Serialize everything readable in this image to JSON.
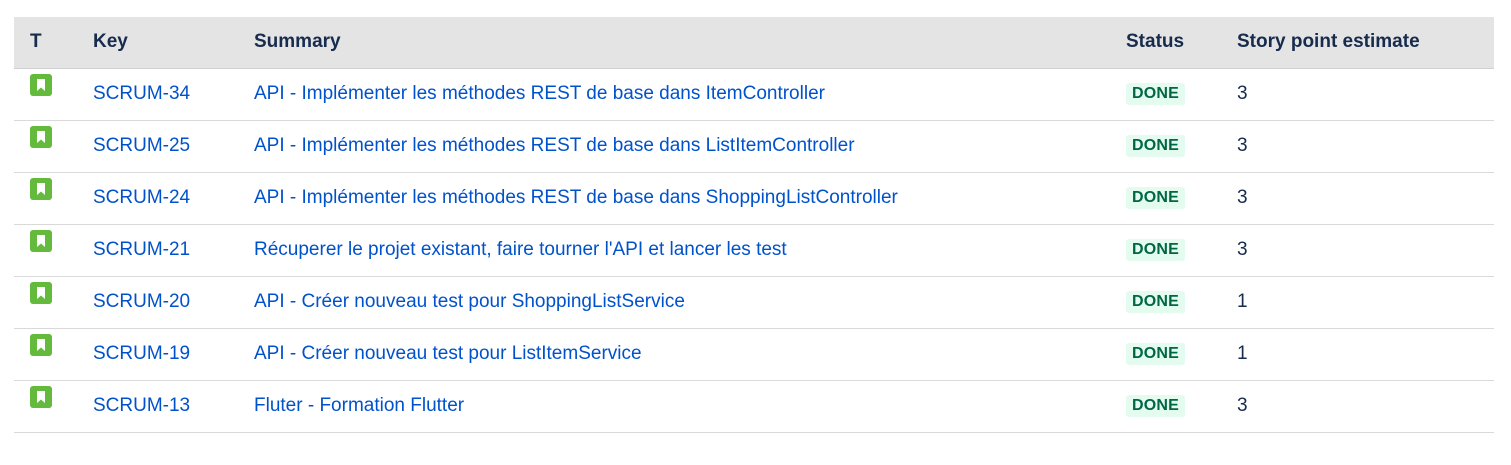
{
  "columns": {
    "type": "T",
    "key": "Key",
    "summary": "Summary",
    "status": "Status",
    "story_points": "Story point estimate"
  },
  "rows": [
    {
      "type_icon": "story-icon",
      "key": "SCRUM-34",
      "summary": "API - Implémenter les méthodes REST de base dans ItemController",
      "status": "DONE",
      "story_points": "3"
    },
    {
      "type_icon": "story-icon",
      "key": "SCRUM-25",
      "summary": "API - Implémenter les méthodes REST de base dans ListItemController",
      "status": "DONE",
      "story_points": "3"
    },
    {
      "type_icon": "story-icon",
      "key": "SCRUM-24",
      "summary": "API - Implémenter les méthodes REST de base dans ShoppingListController",
      "status": "DONE",
      "story_points": "3"
    },
    {
      "type_icon": "story-icon",
      "key": "SCRUM-21",
      "summary": "Récuperer le projet existant, faire tourner l'API et lancer les test",
      "status": "DONE",
      "story_points": "3"
    },
    {
      "type_icon": "story-icon",
      "key": "SCRUM-20",
      "summary": "API - Créer nouveau test pour ShoppingListService",
      "status": "DONE",
      "story_points": "1"
    },
    {
      "type_icon": "story-icon",
      "key": "SCRUM-19",
      "summary": "API - Créer nouveau test pour ListItemService",
      "status": "DONE",
      "story_points": "1"
    },
    {
      "type_icon": "story-icon",
      "key": "SCRUM-13",
      "summary": "Fluter - Formation Flutter",
      "status": "DONE",
      "story_points": "3"
    }
  ],
  "colors": {
    "story_icon": "#63ba3c",
    "link": "#0052cc",
    "done_bg": "#e3fcef",
    "done_text": "#006644",
    "header_bg": "#e4e4e4"
  }
}
